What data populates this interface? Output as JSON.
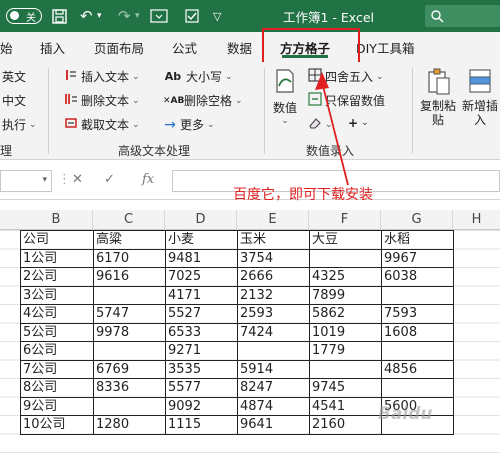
{
  "titlebar": {
    "autosave_state": "关",
    "title": "工作簿1 - Excel",
    "search_icon": "search-icon"
  },
  "tabs": [
    {
      "label": "始"
    },
    {
      "label": "插入"
    },
    {
      "label": "页面布局"
    },
    {
      "label": "公式"
    },
    {
      "label": "数据"
    },
    {
      "label": "方方格子"
    },
    {
      "label": "DIY工具箱"
    }
  ],
  "ribbon": {
    "left_group": {
      "items": [
        "英文",
        "中文",
        "执行"
      ],
      "label": "理"
    },
    "text_group": {
      "label": "高级文本处理",
      "insert_text": "插入文本",
      "delete_text": "删除文本",
      "extract_text": "截取文本",
      "case": "大小写",
      "delete_space": "删除空格",
      "more": "更多"
    },
    "data_group": {
      "label": "数值录入",
      "number": "数值",
      "round": "四舍五入",
      "keep_value": "只保留数值",
      "plus": "+"
    },
    "right_group": {
      "copy_paste": "复制粘贴",
      "add_insert": "新增插入"
    }
  },
  "formula_bar": {
    "fx_label": "fx"
  },
  "annotation": {
    "text": "百度它，即可下载安装"
  },
  "columns": [
    "B",
    "C",
    "D",
    "E",
    "F",
    "G",
    "H"
  ],
  "table": {
    "headers": [
      "公司",
      "高粱",
      "小麦",
      "玉米",
      "大豆",
      "水稻"
    ],
    "rows": [
      [
        "1公司",
        "6170",
        "9481",
        "3754",
        "",
        "9967"
      ],
      [
        "2公司",
        "9616",
        "7025",
        "2666",
        "4325",
        "6038"
      ],
      [
        "3公司",
        "",
        "4171",
        "2132",
        "7899",
        ""
      ],
      [
        "4公司",
        "5747",
        "5527",
        "2593",
        "5862",
        "7593"
      ],
      [
        "5公司",
        "9978",
        "6533",
        "7424",
        "1019",
        "1608"
      ],
      [
        "6公司",
        "",
        "9271",
        "",
        "1779",
        ""
      ],
      [
        "7公司",
        "6769",
        "3535",
        "5914",
        "",
        "4856"
      ],
      [
        "8公司",
        "8336",
        "5577",
        "8247",
        "9745",
        ""
      ],
      [
        "9公司",
        "",
        "9092",
        "4874",
        "4541",
        "5600"
      ],
      [
        "10公司",
        "1280",
        "1115",
        "9641",
        "2160",
        ""
      ]
    ]
  },
  "watermark": "Baidu"
}
